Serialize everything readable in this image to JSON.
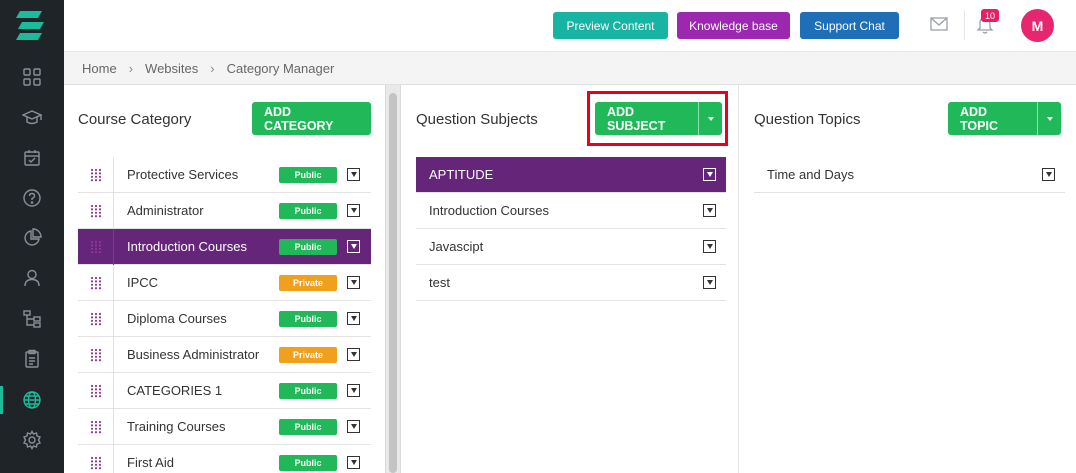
{
  "header": {
    "preview_label": "Preview Content",
    "kb_label": "Knowledge base",
    "chat_label": "Support Chat",
    "notification_count": "10",
    "avatar_initial": "M"
  },
  "breadcrumb": [
    "Home",
    "Websites",
    "Category Manager"
  ],
  "sidebar": {
    "icons": [
      "dashboard-icon",
      "graduation-cap-icon",
      "calendar-check-icon",
      "help-circle-icon",
      "pie-chart-icon",
      "user-icon",
      "hierarchy-icon",
      "clipboard-icon",
      "globe-icon",
      "gear-icon"
    ],
    "active_index": 8
  },
  "course_category": {
    "title": "Course Category",
    "add_label": "ADD CATEGORY",
    "items": [
      {
        "label": "Protective Services",
        "status": "Public"
      },
      {
        "label": "Administrator",
        "status": "Public"
      },
      {
        "label": "Introduction Courses",
        "status": "Public",
        "active": true
      },
      {
        "label": "IPCC",
        "status": "Private"
      },
      {
        "label": "Diploma Courses",
        "status": "Public"
      },
      {
        "label": "Business Administrator",
        "status": "Private"
      },
      {
        "label": "CATEGORIES 1",
        "status": "Public"
      },
      {
        "label": "Training Courses",
        "status": "Public"
      },
      {
        "label": "First Aid",
        "status": "Public"
      }
    ]
  },
  "question_subjects": {
    "title": "Question Subjects",
    "add_label": "ADD SUBJECT",
    "items": [
      {
        "label": "APTITUDE",
        "active": true
      },
      {
        "label": "Introduction Courses"
      },
      {
        "label": "Javascipt"
      },
      {
        "label": "test"
      }
    ]
  },
  "question_topics": {
    "title": "Question Topics",
    "add_label": "ADD TOPIC",
    "items": [
      {
        "label": "Time and Days"
      }
    ]
  },
  "colors": {
    "accent_purple": "#65267a",
    "green": "#21b85a",
    "orange": "#f0a01c",
    "teal": "#17b3a3",
    "magenta": "#9c27b0",
    "blue": "#1e6fb7",
    "highlight_red": "#e8001c"
  }
}
